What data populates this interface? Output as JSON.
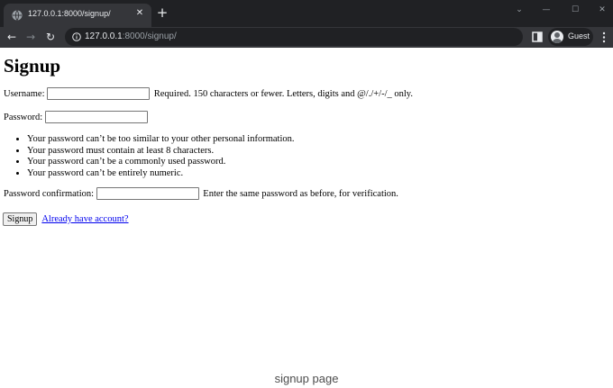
{
  "browser": {
    "tab_title": "127.0.0.1:8000/signup/",
    "tab_close_glyph": "✕",
    "new_tab_glyph": "+",
    "url_host": "127.0.0.1",
    "url_rest": ":8000/signup/",
    "profile_label": "Guest",
    "window_controls": {
      "chevron": "⌄",
      "minimize": "—",
      "maximize": "☐",
      "close": "✕"
    },
    "nav": {
      "back": "←",
      "forward": "→",
      "reload": "↻"
    },
    "theme_color": "#35363a"
  },
  "page": {
    "heading": "Signup",
    "username_label": "Username:",
    "username_help": "Required. 150 characters or fewer. Letters, digits and @/./+/-/_ only.",
    "password_label": "Password:",
    "password_rules": [
      "Your password can’t be too similar to your other personal information.",
      "Your password must contain at least 8 characters.",
      "Your password can’t be a commonly used password.",
      "Your password can’t be entirely numeric."
    ],
    "password_confirm_label": "Password confirmation:",
    "password_confirm_help": "Enter the same password as before, for verification.",
    "submit_label": "Signup",
    "login_link": "Already have account?",
    "link_color": "#0000ee"
  },
  "caption": "signup page"
}
